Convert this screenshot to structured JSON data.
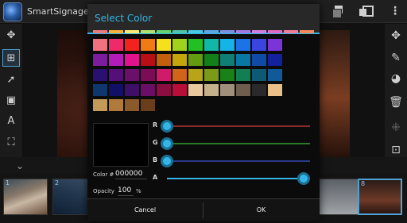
{
  "app": {
    "title": "SmartSignage Ed"
  },
  "icons": {
    "logo": "app-logo-icon",
    "top": [
      "layers-icon",
      "layers-outline-icon",
      "more-icon"
    ],
    "left": [
      "move-icon",
      "add-box-icon",
      "pointer-add-icon",
      "image-add-icon",
      "text-add-icon",
      "fit-icon"
    ],
    "right": [
      "move-icon",
      "pencil-icon",
      "palette-icon",
      "trash-icon",
      "grid-icon",
      "select-icon"
    ]
  },
  "filmstrip": {
    "thumbs": [
      {
        "num": "1"
      },
      {
        "num": "2"
      },
      {
        "num": ""
      },
      {
        "num": "8"
      }
    ]
  },
  "dialog": {
    "title": "Select Color",
    "accent": "#33b5e5",
    "palette": [
      [
        "#e97b7f",
        "#f5b13e",
        "#f7ec73",
        "#b0e070",
        "#64d56c",
        "#4cc4a6",
        "#47c9e8",
        "#5aa7e6",
        "#7b8fe0",
        "#a37be0",
        "#d07ee0",
        "#e06ac5",
        "#f07c9c",
        "#f4885e"
      ],
      [
        "#f0727f",
        "#ee2a6b",
        "#f2231f",
        "#f07a14",
        "#f6e01c",
        "#a0d41c",
        "#22c022",
        "#11b8a6",
        "#14b4e8",
        "#1c73e8",
        "#3a45e0",
        "#7a34d8"
      ],
      [
        "#7d1c9e",
        "#b31cb8",
        "#e0128c",
        "#b80e16",
        "#c2600c",
        "#c2a60c",
        "#649a10",
        "#127f18",
        "#0e7f72",
        "#0a76a4",
        "#0f4aa4",
        "#12219c"
      ],
      [
        "#2a1070",
        "#541078",
        "#6a0f6a",
        "#7d0c58",
        "#d01a6a",
        "#d06418",
        "#b8a418",
        "#7a9a18",
        "#188218",
        "#127f52",
        "#0e5a74",
        "#105a9a"
      ],
      [
        "#10366e",
        "#120f66",
        "#3e0f66",
        "#6a0f66",
        "#8a0f40",
        "#b80f3a",
        "#e8c89c",
        "#c4b08a",
        "#a08f7a",
        "#6e5e4e",
        "#2a2a2a",
        "#e8c088"
      ],
      [
        "#c49a5a",
        "#b07a3a",
        "#8a5a2a",
        "#6a3e1a"
      ]
    ],
    "sliders": [
      {
        "label": "R",
        "value": 0,
        "color": "#8a2a2a"
      },
      {
        "label": "G",
        "value": 0,
        "color": "#2a7a2a"
      },
      {
        "label": "B",
        "value": 0,
        "color": "#2a3a8a"
      },
      {
        "label": "A",
        "value": 255,
        "color": "#33b5e5"
      }
    ],
    "preview_color": "#000000",
    "color_label": "Color #",
    "color_value": "000000",
    "opacity_label": "Opacity",
    "opacity_value": "100",
    "opacity_unit": "%",
    "cancel_label": "Cancel",
    "ok_label": "OK"
  }
}
